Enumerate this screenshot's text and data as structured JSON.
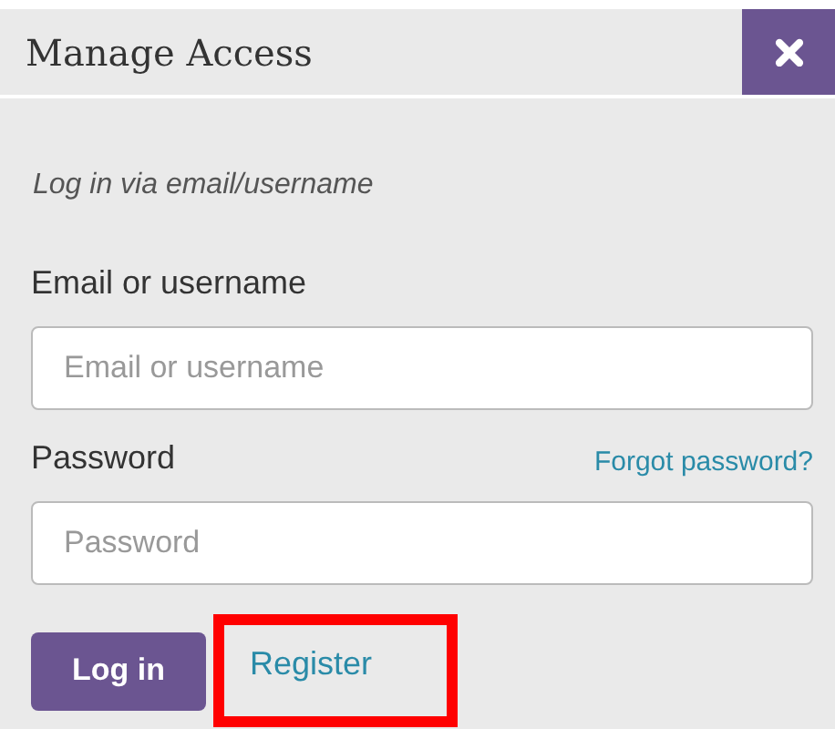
{
  "dialog": {
    "title": "Manage Access"
  },
  "subtitle": "Log in via email/username",
  "fields": [
    {
      "label": "Email or username",
      "placeholder": "Email or username"
    },
    {
      "label": "Password",
      "placeholder": "Password",
      "link": "Forgot password?"
    }
  ],
  "login_button": "Log in",
  "register_link": {
    "label": "Register",
    "highlighted": true
  }
}
